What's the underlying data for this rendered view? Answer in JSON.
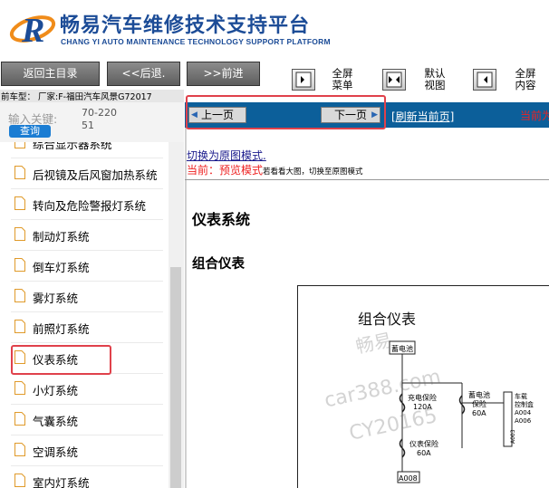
{
  "header": {
    "title": "畅易汽车维修技术支持平台",
    "subtitle": "CHANG YI AUTO MAINTENANCE TECHNOLOGY SUPPORT PLATFORM"
  },
  "toolbar": {
    "home_label": "返回主目录",
    "back_label": "<<后退.",
    "forward_label": ">>前进",
    "fullscreen_menu": [
      "全屏",
      "菜单"
    ],
    "default_view": [
      "默认",
      "视图"
    ],
    "fullscreen_content": [
      "全屏",
      "内容"
    ]
  },
  "vehicle_info": "前车型：  厂家:F-福田汽车风景G72017",
  "sidebar": {
    "search_label": "输入关键:",
    "search_value": "70-22051",
    "query_label": "查询",
    "items": [
      {
        "label": "综合显示器系统"
      },
      {
        "label": "后视镜及后风窗加热系统"
      },
      {
        "label": "转向及危险警报灯系统"
      },
      {
        "label": "制动灯系统"
      },
      {
        "label": "倒车灯系统"
      },
      {
        "label": "雾灯系统"
      },
      {
        "label": "前照灯系统"
      },
      {
        "label": "仪表系统"
      },
      {
        "label": "小灯系统"
      },
      {
        "label": "气囊系统"
      },
      {
        "label": "空调系统"
      },
      {
        "label": "室内灯系统"
      }
    ]
  },
  "content": {
    "prev_label": "上一页",
    "next_label": "下一页",
    "refresh_label": "[刷新当前页]",
    "current_label": "当前为",
    "switch_link": "切换为原图模式.",
    "current_mode_label": "当前：预览模式",
    "current_mode_hint": "若看看大图，切换至原图模式",
    "system_title": "仪表系统",
    "sub_title": "组合仪表"
  },
  "diagram": {
    "title": "组合仪表",
    "battery": "蓄电池",
    "fuse1": [
      "充电保险",
      "120A"
    ],
    "fuse2": [
      "蓄电池",
      "保险",
      "60A"
    ],
    "fuse3": [
      "仪表保险",
      "60A"
    ],
    "fuse4": [
      "车载",
      "控制盒",
      "A004",
      "A006"
    ],
    "conn1": "A008",
    "conn2": "A003",
    "watermark": [
      "畅易",
      "car388.com",
      "CY20165"
    ]
  },
  "colors": {
    "brand_blue": "#1c4c97",
    "content_bar": "#0c5f9a",
    "highlight_red": "#e0414b",
    "alert_red": "#e22222"
  }
}
